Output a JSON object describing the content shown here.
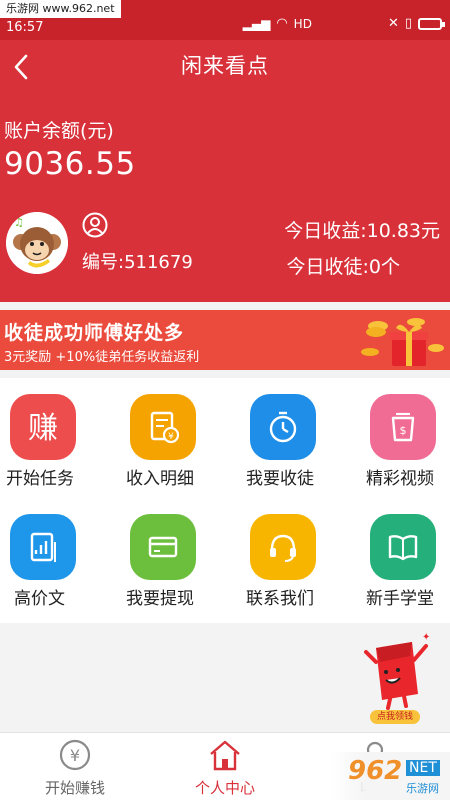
{
  "status": {
    "watermark": "乐游网 www.962.net",
    "time": "16:57",
    "signal": "HD"
  },
  "header": {
    "title": "闲来看点",
    "balance_label": "账户余额(元)",
    "balance_value": "9036.55"
  },
  "user": {
    "id_text": "编号:511679",
    "today_income": "今日收益:10.83元",
    "today_invite": "今日收徒:0个"
  },
  "banner": {
    "title": "收徒成功师傅好处多",
    "subtitle": "3元奖励 +10%徒弟任务收益返利"
  },
  "grid": [
    {
      "label": "开始任务",
      "icon": "zhuan-icon",
      "color": "#ee4d4d"
    },
    {
      "label": "收入明细",
      "icon": "ledger-icon",
      "color": "#f5a300"
    },
    {
      "label": "我要收徒",
      "icon": "stopwatch-icon",
      "color": "#1e8ee8"
    },
    {
      "label": "精彩视频",
      "icon": "video-cup-icon",
      "color": "#f06c94"
    },
    {
      "label": "高价文",
      "icon": "chart-doc-icon",
      "color": "#1e96ea"
    },
    {
      "label": "我要提现",
      "icon": "card-icon",
      "color": "#6cbf3c"
    },
    {
      "label": "联系我们",
      "icon": "headset-icon",
      "color": "#f7b500"
    },
    {
      "label": "新手学堂",
      "icon": "book-icon",
      "color": "#25b07b"
    }
  ],
  "fab": {
    "label": "点我领钱"
  },
  "nav": {
    "items": [
      {
        "label": "开始赚钱",
        "icon": "yen-coin-icon"
      },
      {
        "label": "个人中心",
        "icon": "home-icon"
      },
      {
        "label": "收徒",
        "icon": "person-icon"
      }
    ],
    "active": "#d8313a"
  },
  "brand_mark": {
    "n": "962",
    "net": "NET",
    "sub": "乐游网"
  }
}
